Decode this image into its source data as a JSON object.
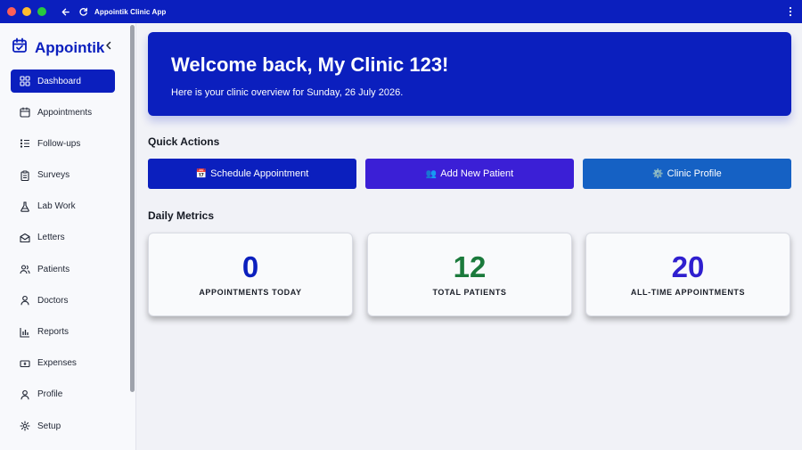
{
  "window": {
    "title": "Appointik Clinic App"
  },
  "colors": {
    "primary": "#0b1fbe",
    "violet": "#3b1fd6",
    "blue": "#1561c4",
    "green": "#1b7a3c",
    "indigo": "#2f1fcf"
  },
  "sidebar": {
    "brand": "Appointik",
    "items": [
      {
        "label": "Dashboard",
        "icon": "grid-icon"
      },
      {
        "label": "Appointments",
        "icon": "calendar-icon"
      },
      {
        "label": "Follow-ups",
        "icon": "list-icon"
      },
      {
        "label": "Surveys",
        "icon": "clipboard-icon"
      },
      {
        "label": "Lab Work",
        "icon": "flask-icon"
      },
      {
        "label": "Letters",
        "icon": "mail-icon"
      },
      {
        "label": "Patients",
        "icon": "users-icon"
      },
      {
        "label": "Doctors",
        "icon": "user-icon"
      },
      {
        "label": "Reports",
        "icon": "bar-chart-icon"
      },
      {
        "label": "Expenses",
        "icon": "money-icon"
      },
      {
        "label": "Profile",
        "icon": "user-icon"
      },
      {
        "label": "Setup",
        "icon": "gear-icon"
      }
    ]
  },
  "hero": {
    "title": "Welcome back, My Clinic 123!",
    "subtitle": "Here is your clinic overview for Sunday, 26 July 2026."
  },
  "quick_actions": {
    "title": "Quick Actions",
    "buttons": [
      {
        "emoji": "📅",
        "label": "Schedule Appointment"
      },
      {
        "emoji": "👥",
        "label": "Add New Patient"
      },
      {
        "emoji": "⚙️",
        "label": "Clinic Profile"
      }
    ]
  },
  "metrics": {
    "title": "Daily Metrics",
    "cards": [
      {
        "value": "0",
        "label": "APPOINTMENTS TODAY"
      },
      {
        "value": "12",
        "label": "TOTAL PATIENTS"
      },
      {
        "value": "20",
        "label": "ALL-TIME APPOINTMENTS"
      }
    ]
  }
}
